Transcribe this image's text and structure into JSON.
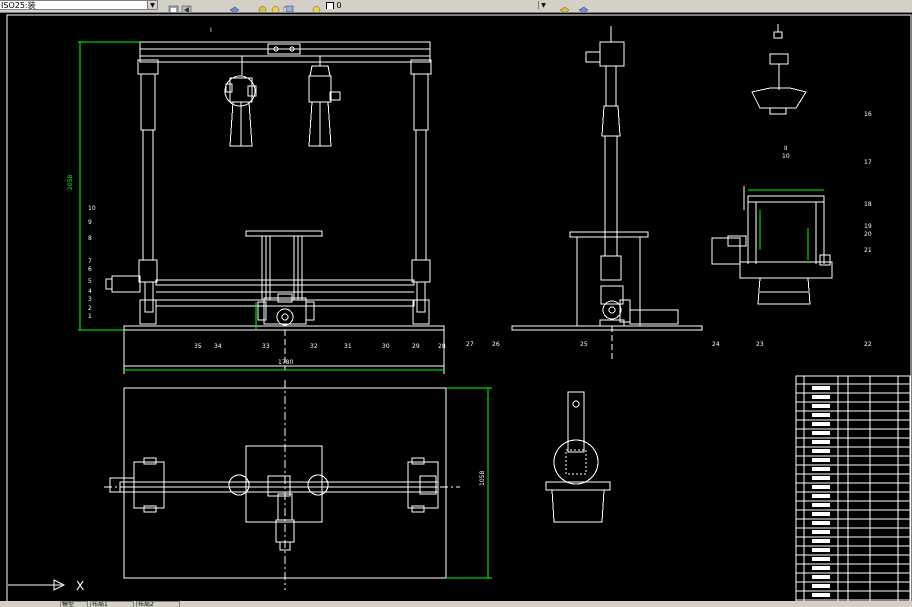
{
  "toolbar": {
    "layer_combo": "ISO25:装",
    "color_combo": "0",
    "icons": [
      "layer-states-icon",
      "layer-prev-icon",
      "layer-props-icon",
      "layer-freeze-icon",
      "layer-lock-icon",
      "layer-color-icon",
      "style-icon",
      "table-style-icon"
    ]
  },
  "drawing": {
    "dim_height": "2058",
    "dim_width": "1780",
    "dim_plan_depth": "1058",
    "front_labels": [
      "10",
      "9",
      "8",
      "7",
      "6",
      "5",
      "4",
      "3",
      "2",
      "1"
    ],
    "bottom_labels": [
      "35",
      "34",
      "33",
      "32",
      "31",
      "30",
      "29",
      "28",
      "27",
      "26",
      "25",
      "24",
      "23",
      "22"
    ],
    "right_labels": [
      "16",
      "17",
      "18",
      "19",
      "20",
      "21"
    ],
    "detail_i": "I",
    "detail_ii": "II",
    "detail_ii_scale": "10"
  },
  "ucs": {
    "x_label": "X"
  },
  "status_tabs": [
    "模型",
    "布局1",
    "布局2"
  ],
  "colors": {
    "background": "#000000",
    "lines": "#ffffff",
    "dimensions": "#00ff00",
    "toolbar": "#d4d0c8"
  }
}
